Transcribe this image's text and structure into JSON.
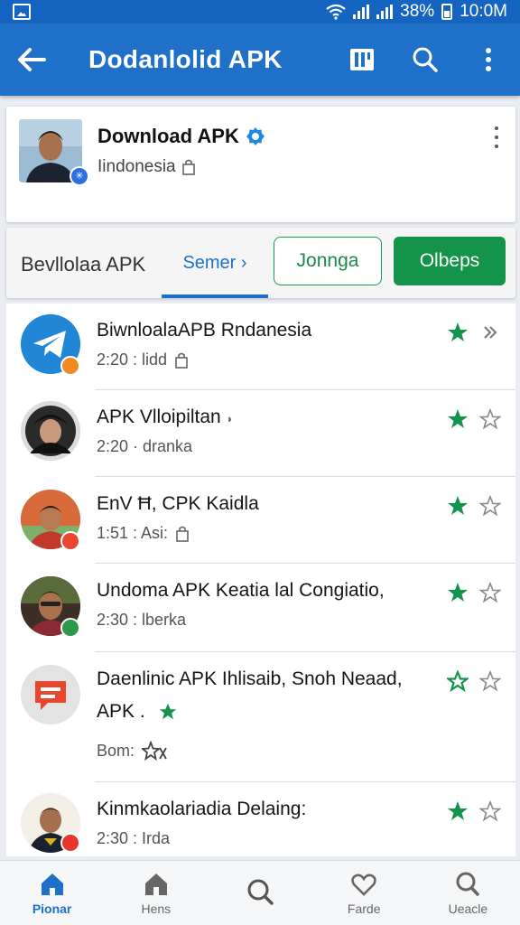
{
  "status_bar": {
    "battery": "38%",
    "time": "10:0M"
  },
  "app_bar": {
    "title": "Dodanlolid APK"
  },
  "profile": {
    "name": "Download APK",
    "location": "Iindonesia"
  },
  "filter": {
    "label": "Bevllolaa APK",
    "tab": "Semer ›",
    "outline_button": "Jonnga",
    "fill_button": "Olbeps"
  },
  "list": [
    {
      "title": "BiwnloalaAPB Rndanesia",
      "sub": "2:20 : lidd",
      "badge_color": "#f08a24"
    },
    {
      "title": "APK Vlloipiltan",
      "title_icon": "◗",
      "sub": "2:20 · dranka",
      "badge_color": ""
    },
    {
      "title": "EnV Ħ, CPK Kaidla",
      "sub": "1:51 : Asi:",
      "badge_color": "#e8462f"
    },
    {
      "title": "Undoma APK Keatia lal Congiatio,",
      "sub": "2:30 : lberka",
      "badge_color": "#2b9b4a"
    },
    {
      "title": "Daenlinic APK Ihlisaib, Snoh Neaad,",
      "title2": "APK .",
      "sub": "Bom:",
      "badge_color": ""
    },
    {
      "title": "Kinmkaolariadia Delaing:",
      "sub": "2:30 : Irda",
      "badge_color": "#e8362f"
    }
  ],
  "bottom_nav": [
    {
      "label": "Pionar",
      "icon": "home-icon"
    },
    {
      "label": "Hens",
      "icon": "home-outline-icon"
    },
    {
      "label": "",
      "icon": "search-icon"
    },
    {
      "label": "Farde",
      "icon": "heart-chat-icon"
    },
    {
      "label": "Ueacle",
      "icon": "search-profile-icon"
    }
  ],
  "colors": {
    "primary": "#1e70c8",
    "green": "#14934a"
  }
}
